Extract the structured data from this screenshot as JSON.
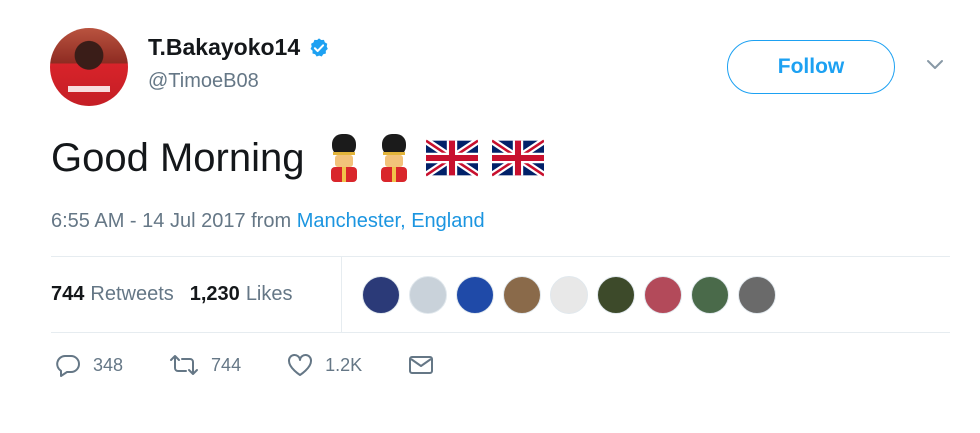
{
  "tweet": {
    "display_name": "T.Bakayoko14",
    "handle": "@TimoeB08",
    "follow_label": "Follow",
    "text": "Good Morning",
    "emojis": [
      "guardsman",
      "guardsman",
      "flag-uk",
      "flag-uk"
    ],
    "timestamp_prefix": "6:55 AM - 14 Jul 2017 from ",
    "location": "Manchester, England"
  },
  "stats": {
    "retweets_count": "744",
    "retweets_label": "Retweets",
    "likes_count": "1,230",
    "likes_label": "Likes"
  },
  "actions": {
    "replies": "348",
    "retweets": "744",
    "likes": "1.2K"
  },
  "colors": {
    "accent": "#1da1f2",
    "link": "#1b95e0",
    "muted": "#657786",
    "text": "#14171a",
    "divider": "#e6ecf0"
  },
  "liker_avatars": [
    {
      "name": "liker-avatar-1",
      "color": "#2b3a78"
    },
    {
      "name": "liker-avatar-2",
      "color": "#c9d2da"
    },
    {
      "name": "liker-avatar-3",
      "color": "#1f4aa8"
    },
    {
      "name": "liker-avatar-4",
      "color": "#8a6a4a"
    },
    {
      "name": "liker-avatar-5",
      "color": "#e8e8e8"
    },
    {
      "name": "liker-avatar-6",
      "color": "#3d4a2a"
    },
    {
      "name": "liker-avatar-7",
      "color": "#b34a5a"
    },
    {
      "name": "liker-avatar-8",
      "color": "#4a6a4a"
    },
    {
      "name": "liker-avatar-9",
      "color": "#6a6a6a"
    }
  ]
}
